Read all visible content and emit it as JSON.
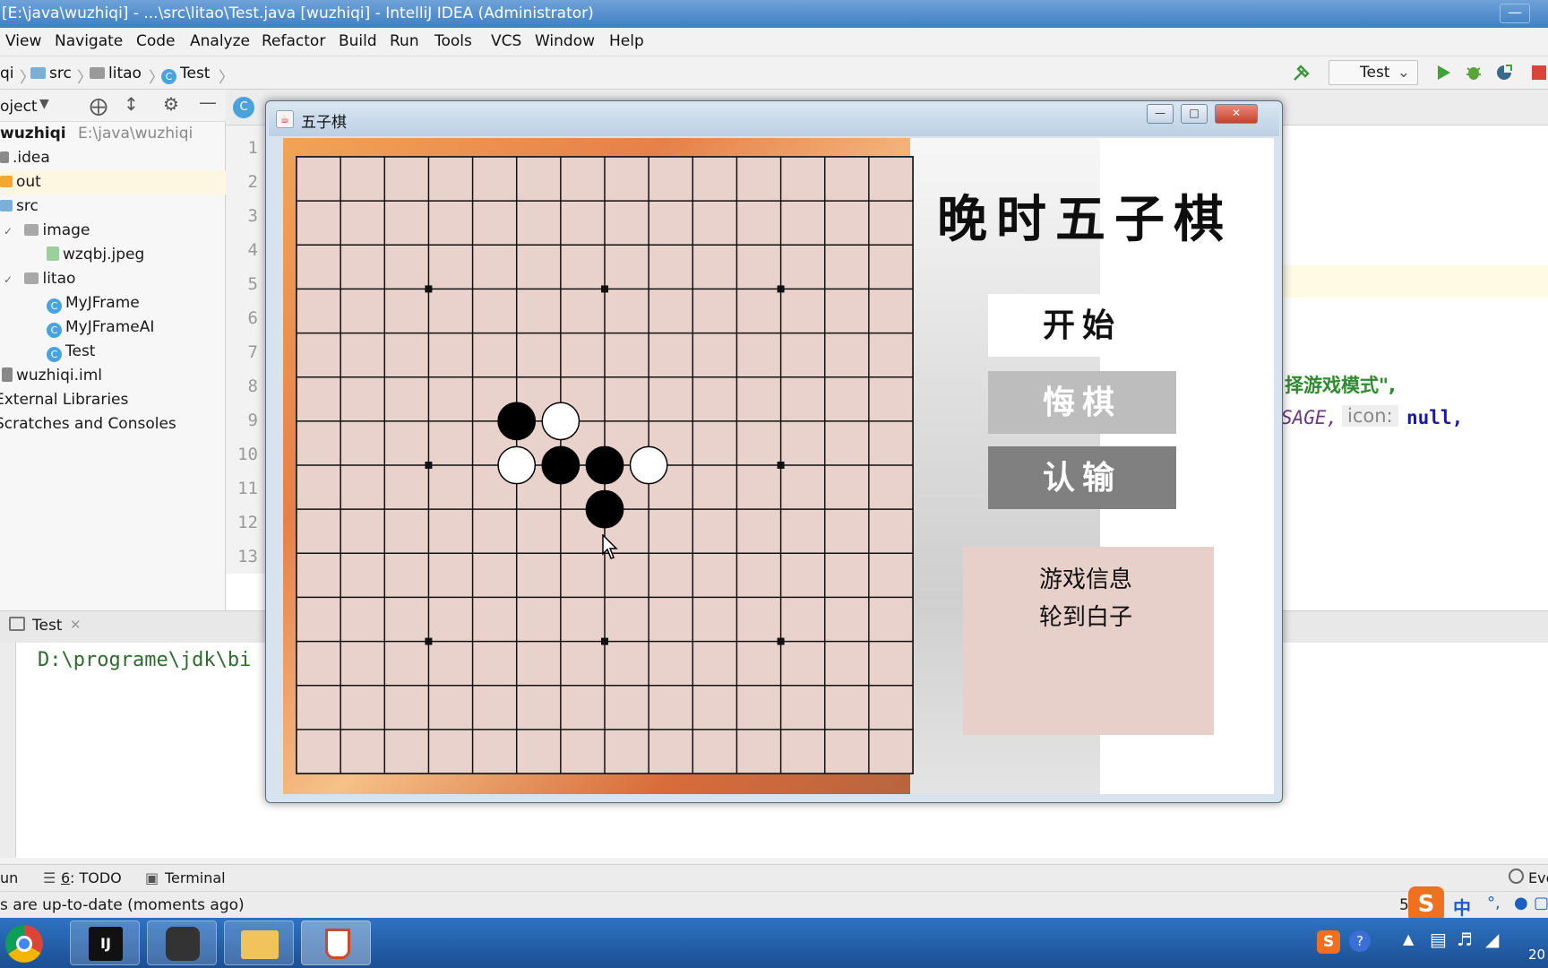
{
  "ide": {
    "title": "[E:\\java\\wuzhiqi] - ...\\src\\litao\\Test.java [wuzhiqi] - IntelliJ IDEA (Administrator)",
    "menu": [
      "View",
      "Navigate",
      "Code",
      "Analyze",
      "Refactor",
      "Build",
      "Run",
      "Tools",
      "VCS",
      "Window",
      "Help"
    ],
    "breadcrumbs": [
      "qi",
      "src",
      "litao",
      "Test"
    ],
    "run_config": "Test",
    "project_header": "oject"
  },
  "project_tree": [
    {
      "label": "wuzhiqi",
      "extra": "E:\\java\\wuzhiqi",
      "icon": "module-folder-icon"
    },
    {
      "label": ".idea",
      "icon": "folder-icon"
    },
    {
      "label": "out",
      "icon": "folder-icon"
    },
    {
      "label": "src",
      "icon": "folder-icon"
    },
    {
      "label": "image",
      "icon": "folder-icon"
    },
    {
      "label": "wzqbj.jpeg",
      "icon": "image-file-icon"
    },
    {
      "label": "litao",
      "icon": "package-icon"
    },
    {
      "label": "MyJFrame",
      "icon": "class-icon"
    },
    {
      "label": "MyJFrameAI",
      "icon": "class-icon"
    },
    {
      "label": "Test",
      "icon": "class-icon"
    },
    {
      "label": "wuzhiqi.iml",
      "icon": "iml-file-icon"
    },
    {
      "label": "External Libraries",
      "icon": "library-icon"
    },
    {
      "label": "Scratches and Consoles",
      "icon": "scratches-icon"
    }
  ],
  "editor": {
    "line_numbers": [
      "1",
      "2",
      "3",
      "4",
      "5",
      "6",
      "7",
      "8",
      "9",
      "10",
      "11",
      "12",
      "13"
    ],
    "code_line_8": "择游戏模式\",",
    "code_line_9_a": "SAGE,",
    "code_line_9_hint": "icon:",
    "code_line_9_b": "null,"
  },
  "run_panel": {
    "tab": "Test",
    "command": "D:\\programe\\jdk\\bi"
  },
  "bottom_tools": {
    "run": "un",
    "todo_num": "6",
    "todo": ": TODO",
    "terminal": "Terminal",
    "event": "Eve"
  },
  "status": {
    "message": "s are up-to-date (moments ago)",
    "position": "5",
    "ime": "中"
  },
  "taskbar": {
    "clock": "20"
  },
  "game": {
    "window_title": "五子棋",
    "title": "晚时五子棋",
    "buttons": {
      "start": "开始",
      "undo": "悔棋",
      "resign": "认输"
    },
    "info_title": "游戏信息",
    "info_status": "轮到白子",
    "board_size": 15,
    "star_points": [
      [
        3,
        3
      ],
      [
        3,
        7
      ],
      [
        3,
        11
      ],
      [
        7,
        3
      ],
      [
        7,
        11
      ],
      [
        11,
        3
      ],
      [
        11,
        7
      ],
      [
        11,
        11
      ]
    ],
    "stones": [
      {
        "col": 5,
        "row": 6,
        "color": "black"
      },
      {
        "col": 6,
        "row": 6,
        "color": "white"
      },
      {
        "col": 5,
        "row": 7,
        "color": "white"
      },
      {
        "col": 6,
        "row": 7,
        "color": "black"
      },
      {
        "col": 7,
        "row": 7,
        "color": "black"
      },
      {
        "col": 8,
        "row": 7,
        "color": "white"
      },
      {
        "col": 7,
        "row": 8,
        "color": "black"
      }
    ]
  },
  "colors": {
    "board": "#e9d2cb",
    "grid": "#111111",
    "ide_title": "#3e7fc3",
    "undo_button": "#bdbdbd",
    "resign_button": "#808080",
    "info_box": "#e8d0ca"
  }
}
